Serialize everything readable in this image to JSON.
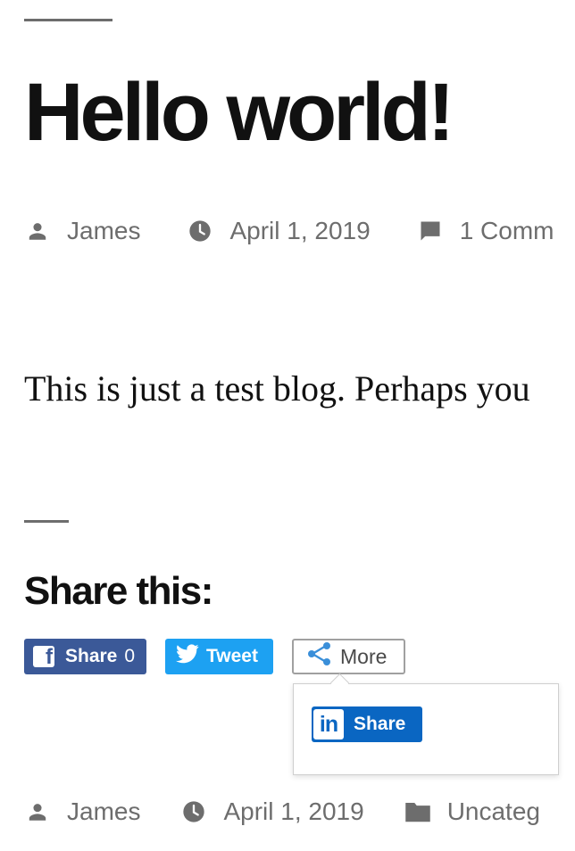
{
  "post": {
    "title": "Hello world!",
    "meta_top": {
      "author": "James",
      "date": "April 1, 2019",
      "comments": "1 Comm"
    },
    "excerpt": "This is just a test blog. Perhaps you",
    "meta_bottom": {
      "author": "James",
      "date": "April 1, 2019",
      "category": "Uncateg"
    }
  },
  "share": {
    "heading": "Share this:",
    "facebook": {
      "icon": "facebook-icon",
      "label": "Share",
      "count": "0",
      "color": "#3b5998"
    },
    "twitter": {
      "icon": "twitter-bird-icon",
      "label": "Tweet",
      "color": "#1da1f2"
    },
    "more": {
      "icon": "share-nodes-icon",
      "label": "More"
    },
    "popup": {
      "linkedin": {
        "icon": "linkedin-icon",
        "icon_text": "in",
        "label": "Share",
        "color": "#0a66c2"
      }
    }
  }
}
